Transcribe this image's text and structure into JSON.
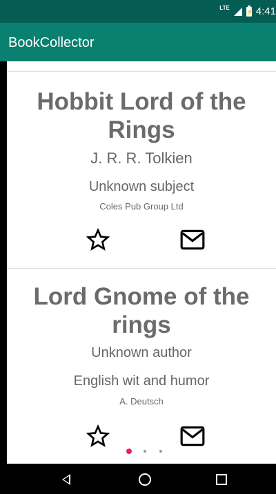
{
  "status": {
    "network": "LTE",
    "time": "4:41"
  },
  "app": {
    "title": "BookCollector"
  },
  "books": [
    {
      "title": "Hobbit Lord of the Rings",
      "author": "J. R. R. Tolkien",
      "subject": "Unknown subject",
      "publisher": "Coles Pub Group Ltd"
    },
    {
      "title": "Lord Gnome of the rings",
      "author": "Unknown author",
      "subject": "English wit and humor",
      "publisher": "A. Deutsch"
    }
  ],
  "pager": {
    "active_index": 0,
    "count": 3
  },
  "icons": {
    "favorite": "star-outline-icon",
    "share": "mail-icon",
    "back": "back-icon",
    "home": "home-icon",
    "recent": "recent-apps-icon"
  },
  "colors": {
    "status_bar": "#055c52",
    "app_bar": "#098070",
    "accent": "#e91e63",
    "text_gray": "#666666"
  }
}
